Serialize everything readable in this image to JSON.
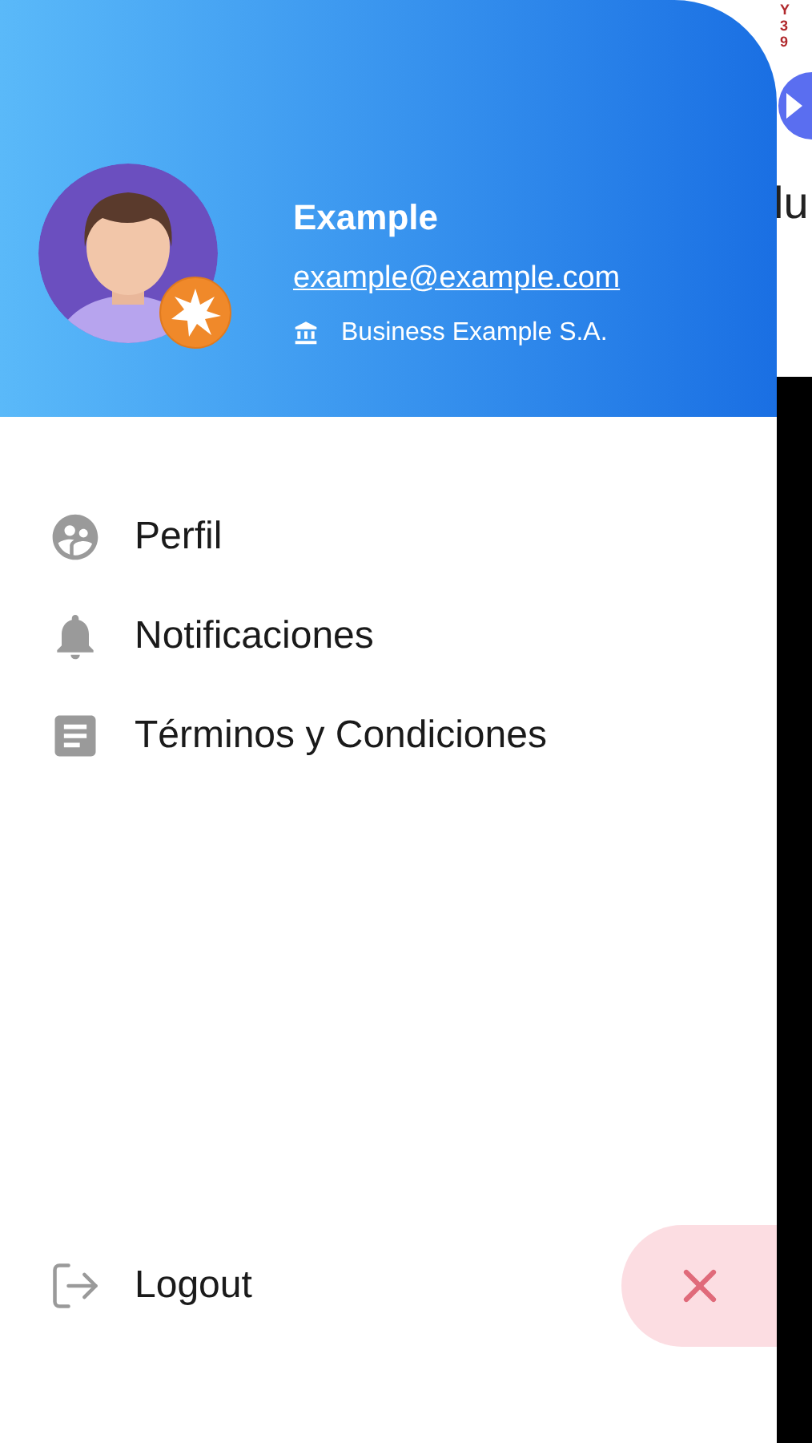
{
  "drawer": {
    "header": {
      "name": "Example",
      "email": "example@example.com",
      "company": "Business Example S.A."
    },
    "menu": [
      {
        "kind": "profile",
        "label": "Perfil"
      },
      {
        "kind": "notifications",
        "label": "Notificaciones"
      },
      {
        "kind": "terms",
        "label": "Términos y Condiciones"
      }
    ],
    "logout": {
      "label": "Logout"
    }
  },
  "background": {
    "side_label": "Y 39",
    "title": "lu"
  }
}
